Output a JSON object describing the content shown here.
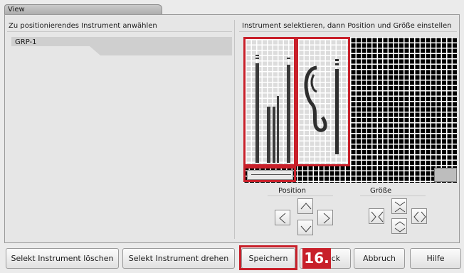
{
  "window": {
    "title": "View"
  },
  "left_panel": {
    "title": "Zu positionierendes Instrument anwählen",
    "items": [
      {
        "label": "GRP-1"
      }
    ]
  },
  "right_panel": {
    "title": "Instrument selektieren, dann Position und Größe einstellen",
    "position_label": "Position",
    "size_label": "Größe",
    "position_buttons": [
      "arrow-up-icon",
      "arrow-left-icon",
      "arrow-right-icon",
      "arrow-down-icon"
    ],
    "size_buttons": [
      "shrink-horizontal-icon",
      "grow-horizontal-icon",
      "shrink-vertical-icon",
      "grow-vertical-icon"
    ]
  },
  "buttons": {
    "delete": "Selekt Instrument löschen",
    "rotate": "Selekt Instrument drehen",
    "save": "Speichern",
    "back": "ck",
    "cancel": "Abbruch",
    "help": "Hilfe"
  },
  "annotation": {
    "step": "16."
  },
  "colors": {
    "highlight": "#c8202a",
    "grid_bg": "#000000",
    "grid_line": "#ffffff"
  }
}
